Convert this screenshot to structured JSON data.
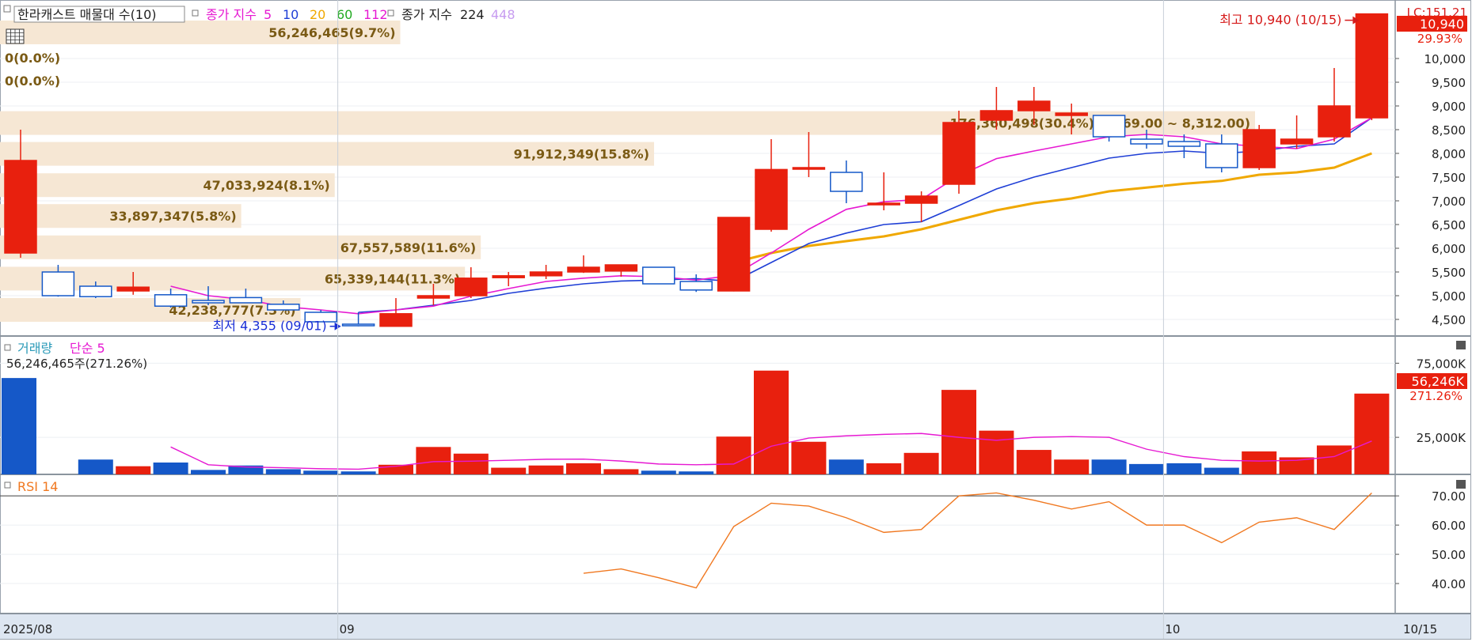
{
  "legend": {
    "price_title": "한라캐스트 매물대 수(10)",
    "ma_label": "종가 지수",
    "ma_periods": [
      "5",
      "10",
      "20",
      "60",
      "112"
    ],
    "ma_colors": [
      "#e619d2",
      "#1f3fd6",
      "#f0a800",
      "#22aa22",
      "#e619d2"
    ],
    "ma_long_label": "종가 지수",
    "ma_long_periods": [
      "224",
      "448"
    ],
    "ma_long_colors": [
      "#222222",
      "#c79cf0"
    ],
    "volume_title": "거래량",
    "volume_ma": "단순 5",
    "volume_info": "56,246,465주(271.26%)",
    "rsi_title": "RSI 14"
  },
  "annotations": {
    "high": "최고 10,940 (10/15)",
    "low": "최저 4,355 (09/01)",
    "price_tag": "10,940",
    "price_pct": "29.93%",
    "corner_label": "LC:151.21",
    "volume_tag": "56,246K",
    "volume_pct": "271.26%",
    "zero1": "0(0.0%)",
    "zero2": "0(0.0%)"
  },
  "xaxis": {
    "labels": [
      "2025/08",
      "09",
      "10",
      "10/15"
    ],
    "label_dates": [
      "08/18",
      "09/01",
      "10/01",
      "10/15"
    ]
  },
  "colors": {
    "up": "#e8200e",
    "down": "#1558c8",
    "ma5": "#e619d2",
    "ma10": "#1f3fd6",
    "ma20": "#f0a800",
    "rsi": "#f07820",
    "profile": "#f6e7d4",
    "profile_text": "#7a5a14"
  },
  "chart_data": [
    {
      "type": "candlestick",
      "dates": [
        "08/18",
        "08/19",
        "08/20",
        "08/21",
        "08/22",
        "08/25",
        "08/26",
        "08/27",
        "08/28",
        "09/01",
        "09/02",
        "09/03",
        "09/04",
        "09/05",
        "09/08",
        "09/09",
        "09/10",
        "09/11",
        "09/12",
        "09/15",
        "09/16",
        "09/17",
        "09/18",
        "09/19",
        "09/22",
        "09/23",
        "09/24",
        "09/25",
        "09/26",
        "09/29",
        "09/30",
        "10/01",
        "10/02",
        "10/10",
        "10/13",
        "10/14",
        "10/15"
      ],
      "open": [
        5900,
        5500,
        5200,
        5100,
        5020,
        4900,
        4960,
        4820,
        4650,
        4400,
        4355,
        4950,
        5000,
        5380,
        5420,
        5500,
        5520,
        5600,
        5300,
        5100,
        6400,
        7680,
        7600,
        6950,
        6950,
        7350,
        8700,
        8900,
        8800,
        8800,
        8300,
        8250,
        8200,
        7700,
        8200,
        8350,
        8750
      ],
      "high": [
        8500,
        5650,
        5300,
        5500,
        5150,
        5200,
        5150,
        4900,
        4700,
        4650,
        4950,
        5250,
        5600,
        5500,
        5650,
        5850,
        5650,
        5600,
        5450,
        6650,
        8300,
        8450,
        7850,
        7600,
        7200,
        8900,
        9400,
        9400,
        9050,
        8800,
        8500,
        8400,
        8400,
        8600,
        8800,
        9800,
        10940
      ],
      "low": [
        5800,
        4980,
        4950,
        5020,
        4750,
        4800,
        4880,
        4750,
        4500,
        4355,
        4370,
        4800,
        4950,
        5200,
        5350,
        5480,
        5400,
        5300,
        5080,
        5090,
        6350,
        7500,
        6950,
        6800,
        6550,
        7150,
        8500,
        8600,
        8400,
        8250,
        8100,
        7900,
        7600,
        7650,
        8100,
        8250,
        8700
      ],
      "close": [
        7850,
        5000,
        4980,
        5180,
        4780,
        4850,
        4850,
        4700,
        4450,
        4380,
        4620,
        5000,
        5370,
        5420,
        5500,
        5600,
        5650,
        5250,
        5120,
        6650,
        7660,
        7700,
        7200,
        6950,
        7100,
        8650,
        8900,
        9100,
        8850,
        8350,
        8200,
        8150,
        7700,
        8500,
        8300,
        9000,
        10940
      ],
      "ma5": [
        null,
        null,
        null,
        null,
        5200,
        5000,
        4920,
        4770,
        4700,
        4620,
        4700,
        4780,
        4990,
        5150,
        5300,
        5370,
        5420,
        5400,
        5330,
        5430,
        5900,
        6400,
        6820,
        6980,
        7030,
        7530,
        7890,
        8050,
        8200,
        8350,
        8400,
        8350,
        8200,
        8150,
        8100,
        8300,
        8750
      ],
      "ma10": [
        null,
        null,
        null,
        null,
        null,
        null,
        null,
        null,
        null,
        4650,
        4700,
        4800,
        4900,
        5050,
        5160,
        5250,
        5310,
        5330,
        5360,
        5300,
        5700,
        6100,
        6320,
        6500,
        6560,
        6900,
        7250,
        7500,
        7700,
        7900,
        8000,
        8050,
        8000,
        8050,
        8150,
        8200,
        8750
      ],
      "ma20": [
        null,
        null,
        null,
        null,
        null,
        null,
        null,
        null,
        null,
        null,
        null,
        null,
        null,
        null,
        null,
        null,
        null,
        null,
        null,
        5700,
        5900,
        6050,
        6150,
        6250,
        6400,
        6600,
        6800,
        6950,
        7050,
        7200,
        7280,
        7360,
        7420,
        7550,
        7600,
        7700,
        8000
      ],
      "ylim": [
        4150,
        11100
      ],
      "yticks": [
        "4,500",
        "5,000",
        "5,500",
        "6,000",
        "6,500",
        "7,000",
        "7,500",
        "8,000",
        "8,500",
        "9,000",
        "9,500",
        "10,000"
      ],
      "price_levels": [
        4500,
        5000,
        5500,
        6000,
        6500,
        7000,
        7500,
        8000,
        8500,
        9000,
        9500,
        10000
      ],
      "volume_profile": [
        {
          "label": "56,246,465(9.7%)",
          "price": 10550,
          "volume": 56246465
        },
        {
          "label": "176,360,498(30.4%)(8,969.00 ~ 8,312.00)",
          "price": 8640,
          "volume": 176360498
        },
        {
          "label": "91,912,349(15.8%)",
          "price": 7990,
          "volume": 91912349
        },
        {
          "label": "47,033,924(8.1%)",
          "price": 7330,
          "volume": 47033924
        },
        {
          "label": "33,897,347(5.8%)",
          "price": 6680,
          "volume": 33897347
        },
        {
          "label": "67,557,589(11.6%)",
          "price": 6020,
          "volume": 67557589
        },
        {
          "label": "65,339,144(11.3%)",
          "price": 5360,
          "volume": 65339144
        },
        {
          "label": "42,238,777(7.3%)",
          "price": 4700,
          "volume": 42238777
        }
      ]
    },
    {
      "type": "bar",
      "series_name": "거래량",
      "unit": "K",
      "values": [
        65000,
        10000,
        5500,
        8000,
        3000,
        6000,
        3500,
        2500,
        2000,
        6500,
        18500,
        14000,
        4500,
        6000,
        7500,
        3500,
        2500,
        2000,
        25500,
        70000,
        22000,
        10000,
        7500,
        14500,
        57000,
        29500,
        16500,
        10000,
        10000,
        7000,
        7500,
        4500,
        15500,
        11500,
        19500,
        54500
      ],
      "ma5": [
        null,
        null,
        null,
        null,
        18500,
        6500,
        5000,
        4500,
        3800,
        3500,
        5500,
        8600,
        8900,
        9500,
        10200,
        10300,
        9000,
        7000,
        6500,
        7000,
        19000,
        24500,
        26000,
        27000,
        27600,
        25000,
        23000,
        25000,
        25500,
        25000,
        17000,
        12000,
        9500,
        9000,
        9500,
        12000,
        22500
      ],
      "ylim": [
        0,
        80000
      ],
      "yticks": [
        "25,000K",
        "75,000K"
      ],
      "tick_values": [
        25000,
        75000
      ]
    },
    {
      "type": "line",
      "series_name": "RSI 14",
      "values": [
        null,
        null,
        null,
        null,
        null,
        null,
        null,
        null,
        null,
        null,
        null,
        null,
        null,
        null,
        43.5,
        45,
        42,
        38.5,
        59.5,
        67.5,
        66.5,
        62.5,
        57.5,
        58.5,
        70,
        71,
        68.5,
        65.5,
        68,
        60,
        60,
        54,
        61,
        62.5,
        58.5,
        71
      ],
      "ylim": [
        30,
        76
      ],
      "yticks": [
        "40.00",
        "50.00",
        "60.00",
        "70.00"
      ],
      "tick_values": [
        40,
        50,
        60,
        70
      ]
    }
  ]
}
